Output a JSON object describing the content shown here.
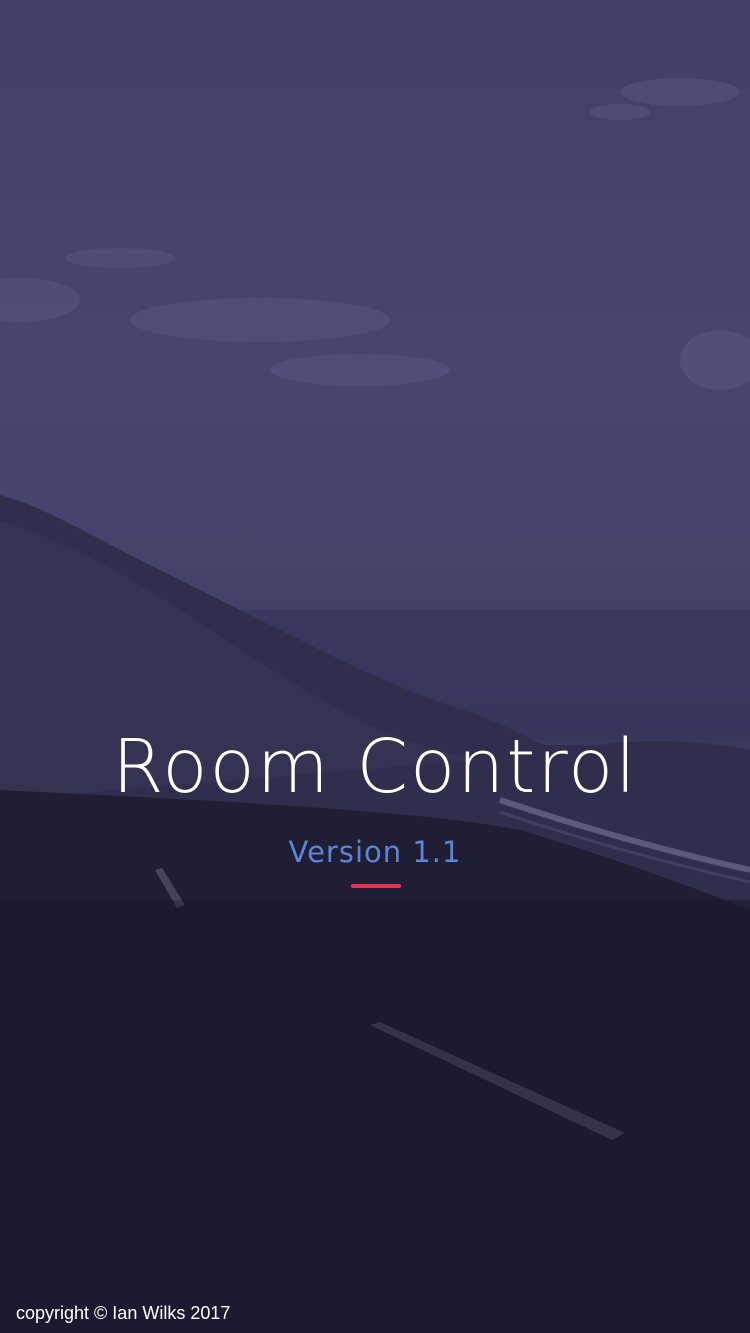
{
  "splash": {
    "title": "Room Control",
    "version": "Version 1.1",
    "copyright": "copyright © Ian Wilks 2017"
  },
  "colors": {
    "title": "#ffffff",
    "version": "#5b86d6",
    "accent": "#e8325c",
    "overlay": "#3f3f6a",
    "ground": "#1c1b30"
  },
  "background": {
    "icon": "landscape-road-photo"
  }
}
